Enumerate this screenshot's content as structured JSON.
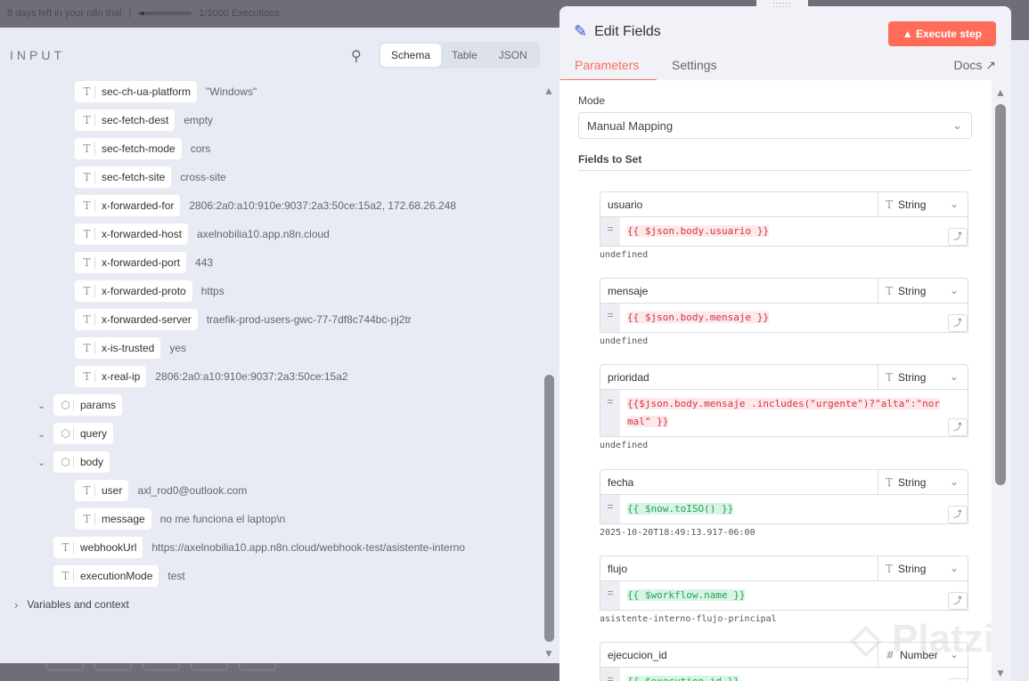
{
  "topbar": {
    "trial": "8 days left in your n8n trial",
    "executions": "1/1000 Executions"
  },
  "input": {
    "title": "INPUT",
    "views": [
      "Schema",
      "Table",
      "JSON"
    ],
    "rows": [
      {
        "level": 2,
        "key": "sec-ch-ua-platform",
        "value": "\"Windows\""
      },
      {
        "level": 2,
        "key": "sec-fetch-dest",
        "value": "empty"
      },
      {
        "level": 2,
        "key": "sec-fetch-mode",
        "value": "cors"
      },
      {
        "level": 2,
        "key": "sec-fetch-site",
        "value": "cross-site"
      },
      {
        "level": 2,
        "key": "x-forwarded-for",
        "value": "2806:2a0:a10:910e:9037:2a3:50ce:15a2, 172.68.26.248"
      },
      {
        "level": 2,
        "key": "x-forwarded-host",
        "value": "axelnobilia10.app.n8n.cloud"
      },
      {
        "level": 2,
        "key": "x-forwarded-port",
        "value": "443"
      },
      {
        "level": 2,
        "key": "x-forwarded-proto",
        "value": "https"
      },
      {
        "level": 2,
        "key": "x-forwarded-server",
        "value": "traefik-prod-users-gwc-77-7df8c744bc-pj2tr"
      },
      {
        "level": 2,
        "key": "x-is-trusted",
        "value": "yes"
      },
      {
        "level": 2,
        "key": "x-real-ip",
        "value": "2806:2a0:a10:910e:9037:2a3:50ce:15a2"
      },
      {
        "level": 1,
        "key": "params",
        "value": "",
        "object": true
      },
      {
        "level": 1,
        "key": "query",
        "value": "",
        "object": true
      },
      {
        "level": 1,
        "key": "body",
        "value": "",
        "object": true
      },
      {
        "level": 2,
        "key": "user",
        "value": "axl_rod0@outlook.com"
      },
      {
        "level": 2,
        "key": "message",
        "value": "no me funciona el laptop\\n"
      },
      {
        "level": 1,
        "key": "webhookUrl",
        "value": "https://axelnobilia10.app.n8n.cloud/webhook-test/asistente-interno"
      },
      {
        "level": 1,
        "key": "executionMode",
        "value": "test"
      }
    ],
    "variables": "Variables and context"
  },
  "node": {
    "title": "Edit Fields",
    "execute": "Execute step",
    "tabs": [
      "Parameters",
      "Settings"
    ],
    "docs": "Docs",
    "mode_label": "Mode",
    "mode": "Manual Mapping",
    "fields_label": "Fields to Set",
    "fields": [
      {
        "name": "usuario",
        "type": "String",
        "expr": "{{ $json.body.usuario }}",
        "status": "error",
        "result": "undefined"
      },
      {
        "name": "mensaje",
        "type": "String",
        "expr": "{{ $json.body.mensaje }}",
        "status": "error",
        "result": "undefined"
      },
      {
        "name": "prioridad",
        "type": "String",
        "expr": "{{$json.body.mensaje .includes(\"urgente\")?\"alta\":\"normal\" }}",
        "status": "error",
        "result": "undefined"
      },
      {
        "name": "fecha",
        "type": "String",
        "expr": "{{ $now.toISO() }}",
        "status": "ok",
        "result": "2025-10-20T18:49:13.917-06:00"
      },
      {
        "name": "flujo",
        "type": "String",
        "expr": "{{ $workflow.name }}",
        "status": "ok",
        "result": "asistente-interno-flujo-principal"
      },
      {
        "name": "ejecucion_id",
        "type": "Number",
        "expr": "{{ $execution.id }}",
        "status": "ok",
        "result": ""
      }
    ]
  },
  "watermark": "Platzi"
}
